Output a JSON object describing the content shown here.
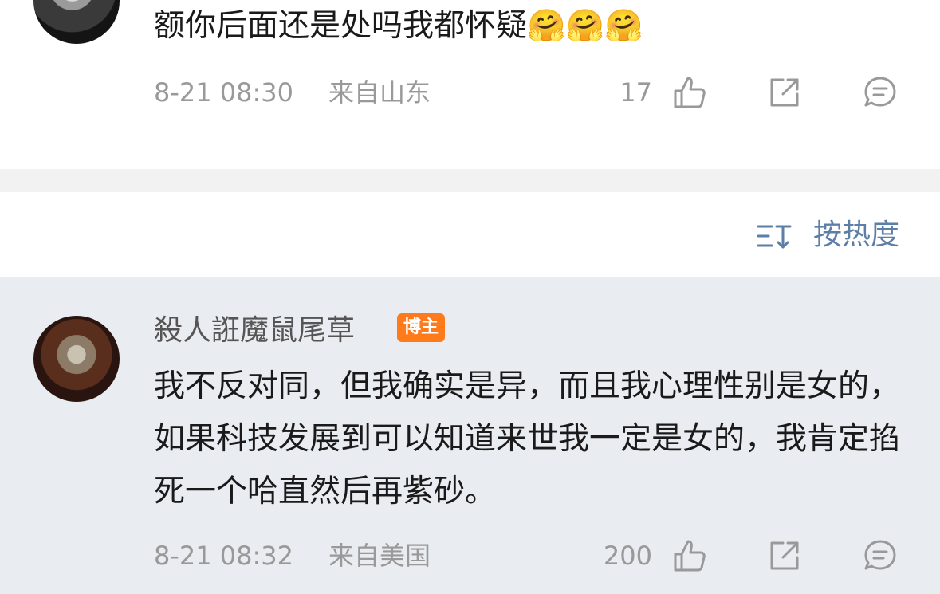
{
  "comment_1": {
    "text": "额你后面还是处吗我都怀疑🤗🤗🤗",
    "date": "8-21 08:30",
    "location": "来自山东",
    "like_count": "17"
  },
  "sort": {
    "label": "按热度",
    "icon": "sort-icon"
  },
  "comment_2": {
    "author": "殺人誑魔鼠尾草",
    "badge": "博主",
    "text": "我不反对同，但我确实是异，而且我心理性别是女的，如果科技发展到可以知道来世我一定是女的，我肯定掐死一个哈直然后再紫砂。",
    "date": "8-21 08:32",
    "location": "来自美国",
    "like_count": "200"
  },
  "colors": {
    "accent": "#5d7ea6",
    "badge": "#ff7a1a",
    "muted_text": "#999999",
    "highlight_bg": "#e9ecf0"
  }
}
